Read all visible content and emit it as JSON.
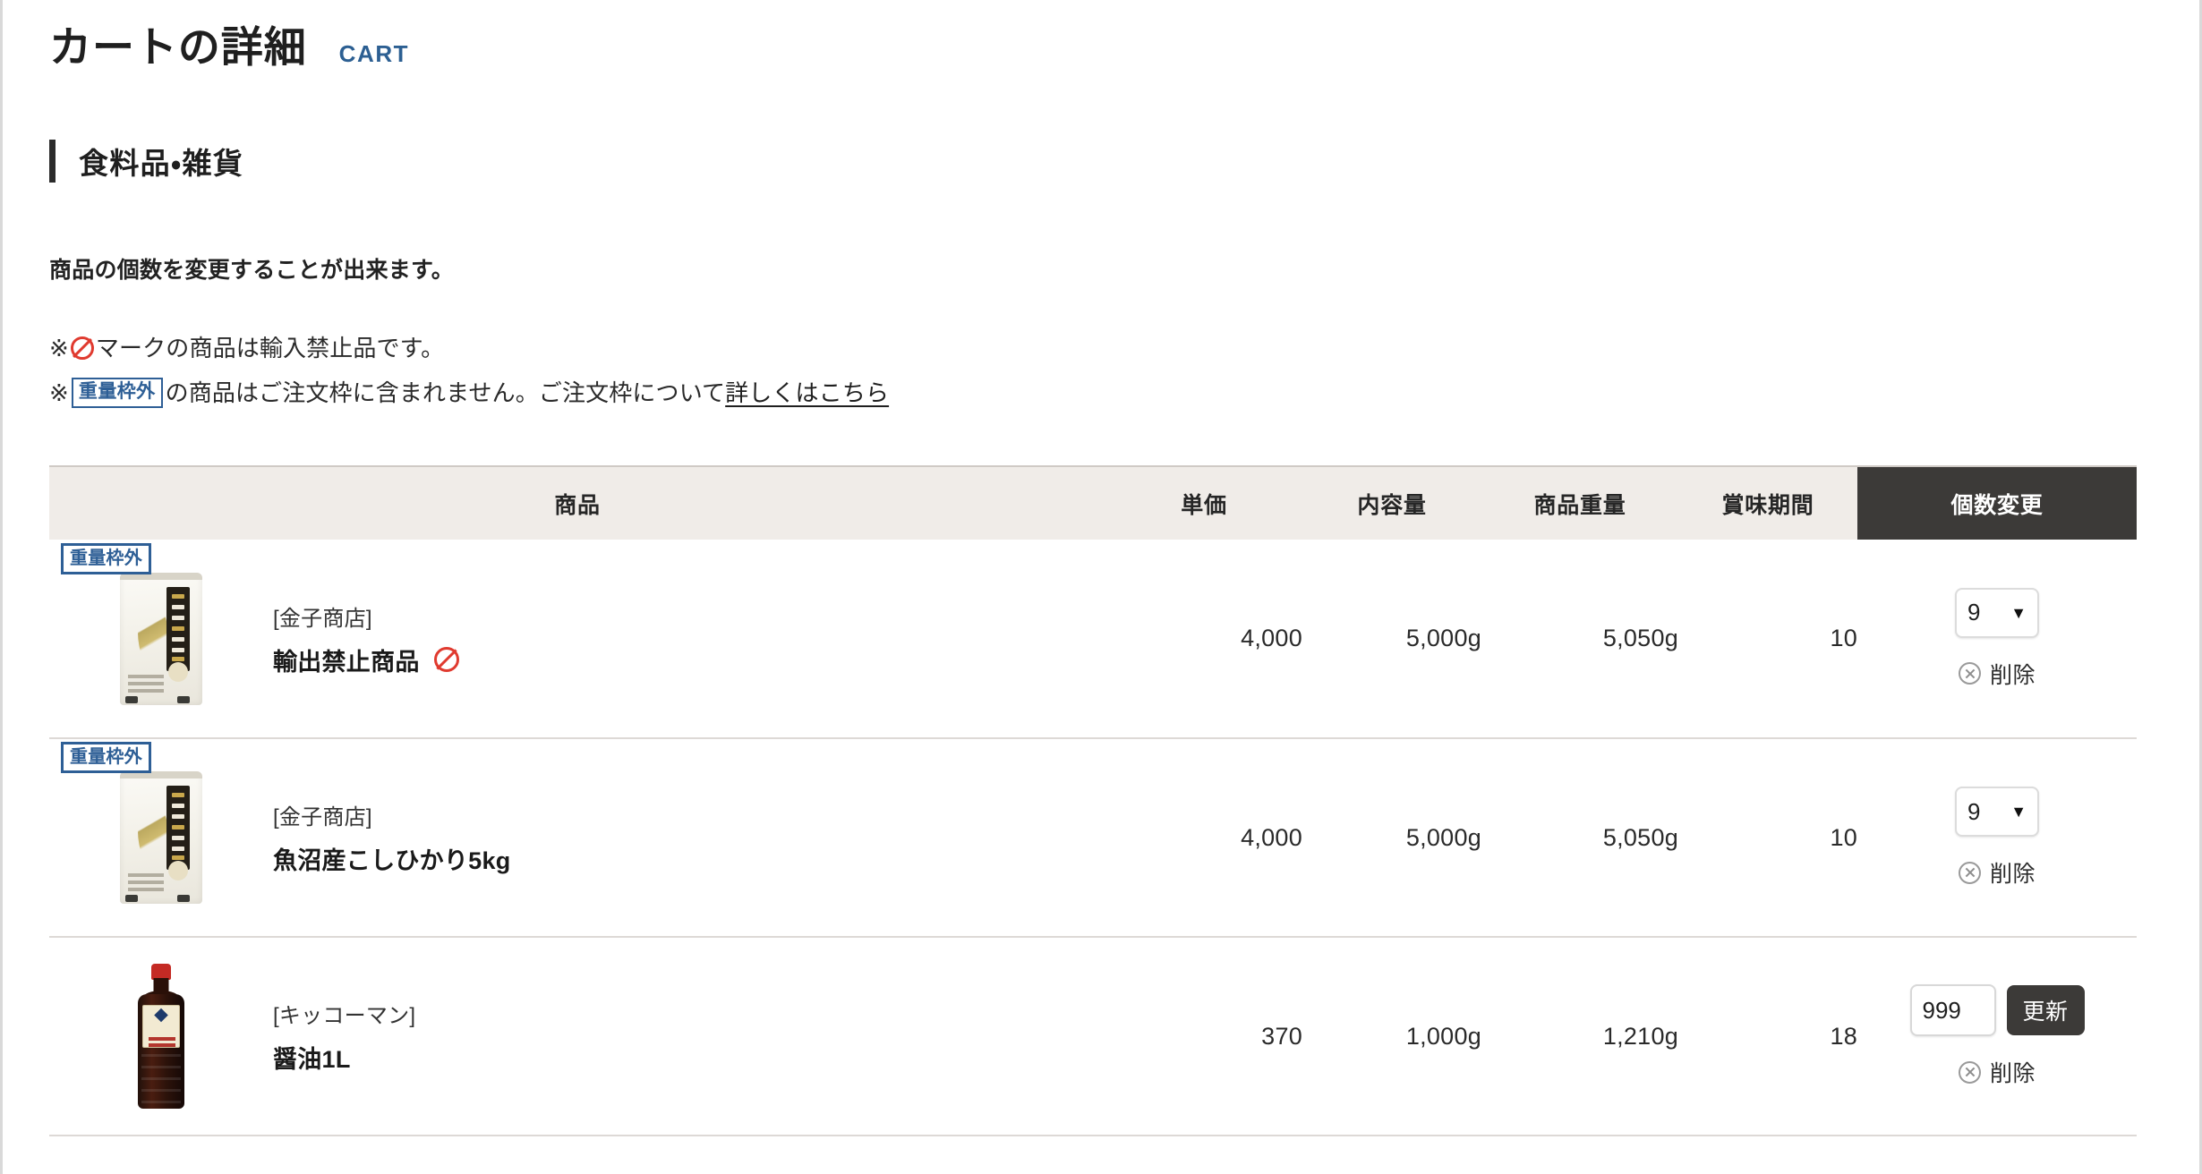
{
  "header": {
    "title": "カートの詳細",
    "title_en": "CART"
  },
  "section": {
    "title": "食料品・雑貨",
    "lead": "商品の個数を変更することが出来ます。"
  },
  "notices": {
    "line1_prefix": "※",
    "line1_icon": "prohibition-icon",
    "line1_text": "マークの商品は輸入禁止品です。",
    "line2_prefix": "※",
    "line2_badge": "重量枠外",
    "line2_text": "の商品はご注文枠に含まれません。ご注文枠について",
    "line2_link": "詳しくはこちら"
  },
  "table": {
    "headers": {
      "product": "商品",
      "unit_price": "単価",
      "volume": "内容量",
      "weight": "商品重量",
      "expiry": "賞味期間",
      "qty_change": "個数変更"
    },
    "rows": [
      {
        "badge": "重量枠外",
        "thumb": "rice-bag-image",
        "shop": "[金子商店]",
        "name": "輸出禁止商品",
        "banned_icon": "prohibition-icon",
        "unit_price": "4,000",
        "volume": "5,000g",
        "weight": "5,050g",
        "expiry": "10",
        "qty_type": "select",
        "qty_value": "9",
        "caret": "▼",
        "delete_label": "削除"
      },
      {
        "badge": "重量枠外",
        "thumb": "rice-bag-image",
        "shop": "[金子商店]",
        "name": "魚沼産こしひかり5kg",
        "unit_price": "4,000",
        "volume": "5,000g",
        "weight": "5,050g",
        "expiry": "10",
        "qty_type": "select",
        "qty_value": "9",
        "caret": "▼",
        "delete_label": "削除"
      },
      {
        "thumb": "soy-sauce-bottle-image",
        "shop": "[キッコーマン]",
        "name": "醤油1L",
        "unit_price": "370",
        "volume": "1,000g",
        "weight": "1,210g",
        "expiry": "18",
        "qty_type": "input",
        "qty_value": "999",
        "update_label": "更新",
        "delete_label": "削除"
      }
    ]
  },
  "colors": {
    "accent_blue": "#2c5f92",
    "badge_blue": "#2e5f96",
    "danger_red": "#e03a2f",
    "header_bg": "#f0ece8",
    "dark": "#3c3a38"
  }
}
